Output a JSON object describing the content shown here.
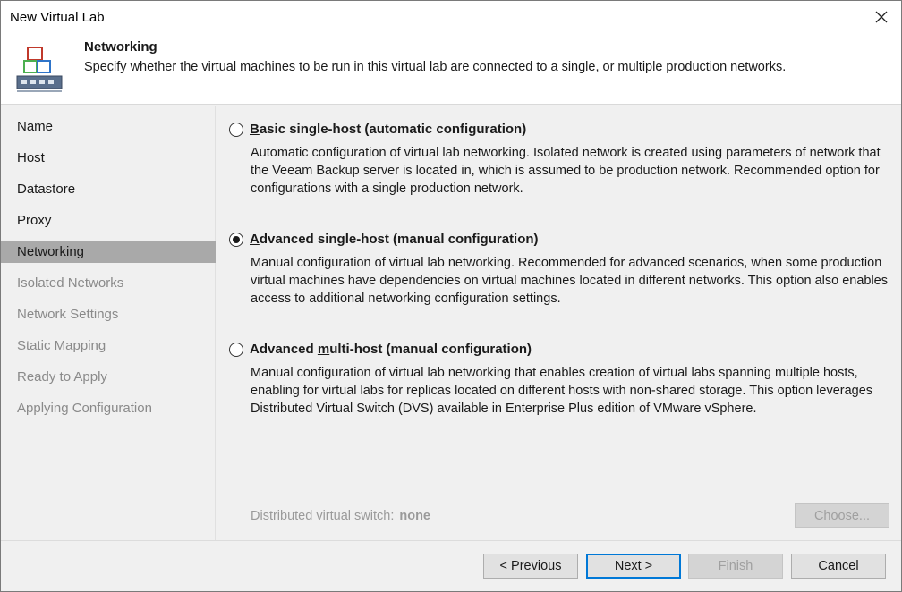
{
  "window": {
    "title": "New Virtual Lab",
    "close_icon": "close-icon"
  },
  "header": {
    "title": "Networking",
    "description": "Specify whether the virtual machines to be run in this virtual lab are connected to a single, or multiple production networks.",
    "icon": "network-lab-icon"
  },
  "sidebar": {
    "items": [
      {
        "label": "Name",
        "state": "normal"
      },
      {
        "label": "Host",
        "state": "normal"
      },
      {
        "label": "Datastore",
        "state": "normal"
      },
      {
        "label": "Proxy",
        "state": "normal"
      },
      {
        "label": "Networking",
        "state": "active"
      },
      {
        "label": "Isolated Networks",
        "state": "disabled"
      },
      {
        "label": "Network Settings",
        "state": "disabled"
      },
      {
        "label": "Static Mapping",
        "state": "disabled"
      },
      {
        "label": "Ready to Apply",
        "state": "disabled"
      },
      {
        "label": "Applying Configuration",
        "state": "disabled"
      }
    ]
  },
  "options": [
    {
      "label_hotkey": "B",
      "label_rest": "asic single-host (automatic configuration)",
      "description": "Automatic configuration of virtual lab networking. Isolated network is created using parameters of network that the Veeam Backup server is located in, which is assumed to be production network. Recommended option for configurations with a single production network.",
      "selected": false
    },
    {
      "label_hotkey": "A",
      "label_rest": "dvanced single-host (manual configuration)",
      "description": "Manual configuration of virtual lab networking. Recommended for advanced scenarios, when some production virtual machines have dependencies on virtual machines located in different networks. This option also enables access to additional networking configuration settings.",
      "selected": true
    },
    {
      "label_pre": "Advanced ",
      "label_hotkey": "m",
      "label_rest": "ulti-host (manual configuration)",
      "description": "Manual configuration of virtual lab networking that enables creation of virtual labs spanning multiple hosts, enabling for virtual labs for replicas located on different hosts with non-shared storage. This option leverages Distributed Virtual Switch (DVS) available in Enterprise Plus edition of VMware vSphere.",
      "selected": false
    }
  ],
  "dvs": {
    "label": "Distributed virtual switch:",
    "value": "none"
  },
  "buttons": {
    "choose": "Choose...",
    "previous_pre": "< ",
    "previous_hotkey": "P",
    "previous_rest": "revious",
    "next_hotkey": "N",
    "next_rest": "ext >",
    "finish_hotkey": "F",
    "finish_rest": "inish",
    "cancel": "Cancel"
  }
}
